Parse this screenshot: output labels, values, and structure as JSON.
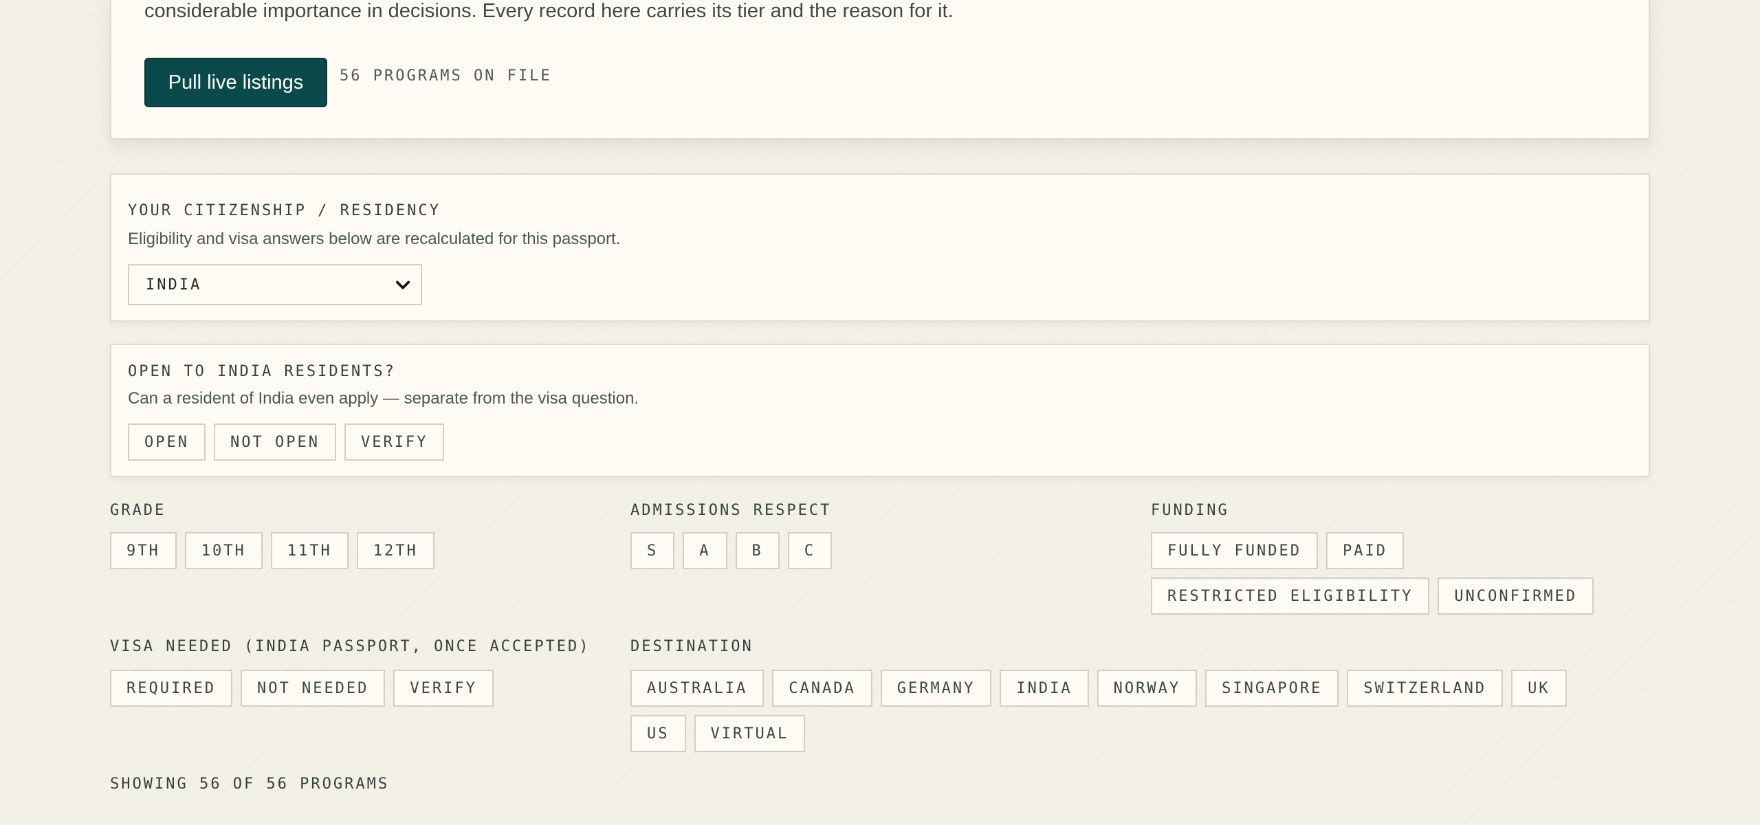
{
  "hero": {
    "text": "considerable importance in decisions. Every record here carries its tier and the reason for it.",
    "pull_button": "Pull live listings",
    "count": "56 PROGRAMS ON FILE"
  },
  "citizenship": {
    "label": "YOUR CITIZENSHIP / RESIDENCY",
    "description": "Eligibility and visa answers below are recalculated for this passport.",
    "selected": "INDIA"
  },
  "open_to": {
    "label": "OPEN TO INDIA RESIDENTS?",
    "description": "Can a resident of India even apply — separate from the visa question.",
    "options": [
      "OPEN",
      "NOT OPEN",
      "VERIFY"
    ]
  },
  "filters": {
    "grade": {
      "label": "GRADE",
      "options": [
        "9TH",
        "10TH",
        "11TH",
        "12TH"
      ]
    },
    "admissions": {
      "label": "ADMISSIONS RESPECT",
      "options": [
        "S",
        "A",
        "B",
        "C"
      ]
    },
    "funding": {
      "label": "FUNDING",
      "options": [
        "FULLY FUNDED",
        "PAID",
        "RESTRICTED ELIGIBILITY",
        "UNCONFIRMED"
      ]
    },
    "visa": {
      "label": "VISA NEEDED (INDIA PASSPORT, ONCE ACCEPTED)",
      "options": [
        "REQUIRED",
        "NOT NEEDED",
        "VERIFY"
      ]
    },
    "destination": {
      "label": "DESTINATION",
      "options": [
        "AUSTRALIA",
        "CANADA",
        "GERMANY",
        "INDIA",
        "NORWAY",
        "SINGAPORE",
        "SWITZERLAND",
        "UK",
        "US",
        "VIRTUAL"
      ]
    }
  },
  "showing": "SHOWING 56 OF 56 PROGRAMS",
  "colors": {
    "accent": "#0b4a4a",
    "panel": "#fdfbf4",
    "background": "#f3f1e6"
  }
}
